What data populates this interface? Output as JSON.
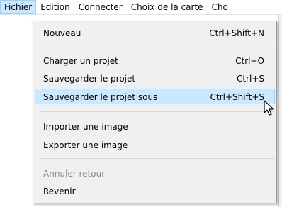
{
  "menubar": {
    "items": [
      {
        "label": "Fichier",
        "active": true
      },
      {
        "label": "Edition"
      },
      {
        "label": "Connecter"
      },
      {
        "label": "Choix de la carte"
      },
      {
        "label": "Cho"
      }
    ]
  },
  "file_menu": {
    "items": [
      {
        "label": "Nouveau",
        "shortcut": "Ctrl+Shift+N"
      },
      {
        "label": "Charger un projet",
        "shortcut": "Ctrl+O"
      },
      {
        "label": "Sauvegarder le projet",
        "shortcut": "Ctrl+S"
      },
      {
        "label": "Sauvegarder le projet sous",
        "shortcut": "Ctrl+Shift+S",
        "highlighted": true
      },
      {
        "label": "Importer une image",
        "shortcut": ""
      },
      {
        "label": "Exporter une image",
        "shortcut": ""
      },
      {
        "label": "Annuler retour",
        "shortcut": "",
        "disabled": true
      },
      {
        "label": "Revenir",
        "shortcut": ""
      }
    ]
  },
  "colors": {
    "highlight_bg": "#cce8ff",
    "highlight_border": "#99d1ff",
    "menu_bg": "#f0f0f0",
    "disabled_text": "#8c8c8c"
  },
  "cursor": {
    "icon": "mouse-pointer-icon"
  }
}
